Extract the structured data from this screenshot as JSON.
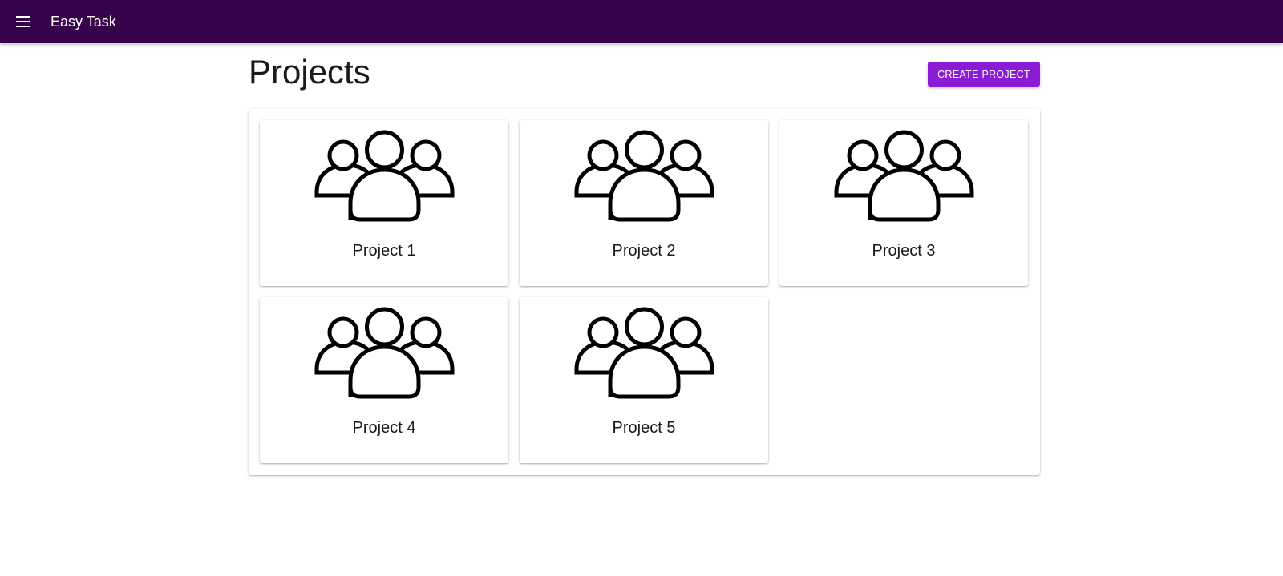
{
  "appbar": {
    "menu_icon": "menu-icon",
    "title": "Easy Task",
    "background": "#37034b"
  },
  "page": {
    "title": "Projects"
  },
  "actions": {
    "create_label": "CREATE PROJECT",
    "accent": "#8b1bd4"
  },
  "projects": [
    {
      "name": "Project 1",
      "icon": "group-icon"
    },
    {
      "name": "Project 2",
      "icon": "group-icon"
    },
    {
      "name": "Project 3",
      "icon": "group-icon"
    },
    {
      "name": "Project 4",
      "icon": "group-icon"
    },
    {
      "name": "Project 5",
      "icon": "group-icon"
    }
  ]
}
